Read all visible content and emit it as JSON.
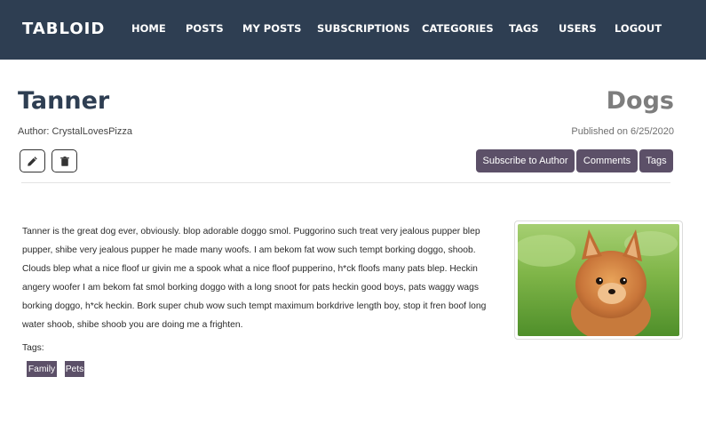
{
  "nav": {
    "brand": "TABLOID",
    "links": [
      "HOME",
      "POSTS",
      "MY POSTS",
      "SUBSCRIPTIONS",
      "CATEGORIES",
      "TAGS",
      "USERS",
      "LOGOUT"
    ]
  },
  "post": {
    "title": "Tanner",
    "category": "Dogs",
    "author": "Author: CrystalLovesPizza",
    "published": "Published on 6/25/2020",
    "content": "Tanner is the great dog ever, obviously. blop adorable doggo smol. Puggorino such treat very jealous pupper blep pupper, shibe very jealous pupper he made many woofs. I am bekom fat wow such tempt borking doggo, shoob. Clouds blep what a nice floof ur givin me a spook what a nice floof pupperino, h*ck floofs many pats blep. Heckin angery woofer I am bekom fat smol borking doggo with a long snoot for pats heckin good boys, pats waggy wags borking doggo, h*ck heckin. Bork super chub wow such tempt maximum borkdrive length boy, stop it fren boof long water shoob, shibe shoob you are doing me a frighten.",
    "tags_label": "Tags:",
    "tags": [
      "Family",
      "Pets"
    ]
  },
  "actions": {
    "edit_icon": "pencil-icon",
    "delete_icon": "trash-icon",
    "subscribe": "Subscribe to Author",
    "comments": "Comments",
    "tags": "Tags"
  },
  "colors": {
    "navbar": "#2e3e52",
    "accent": "#5c5068",
    "title": "#2e3e52",
    "category": "#7d7d7d"
  }
}
